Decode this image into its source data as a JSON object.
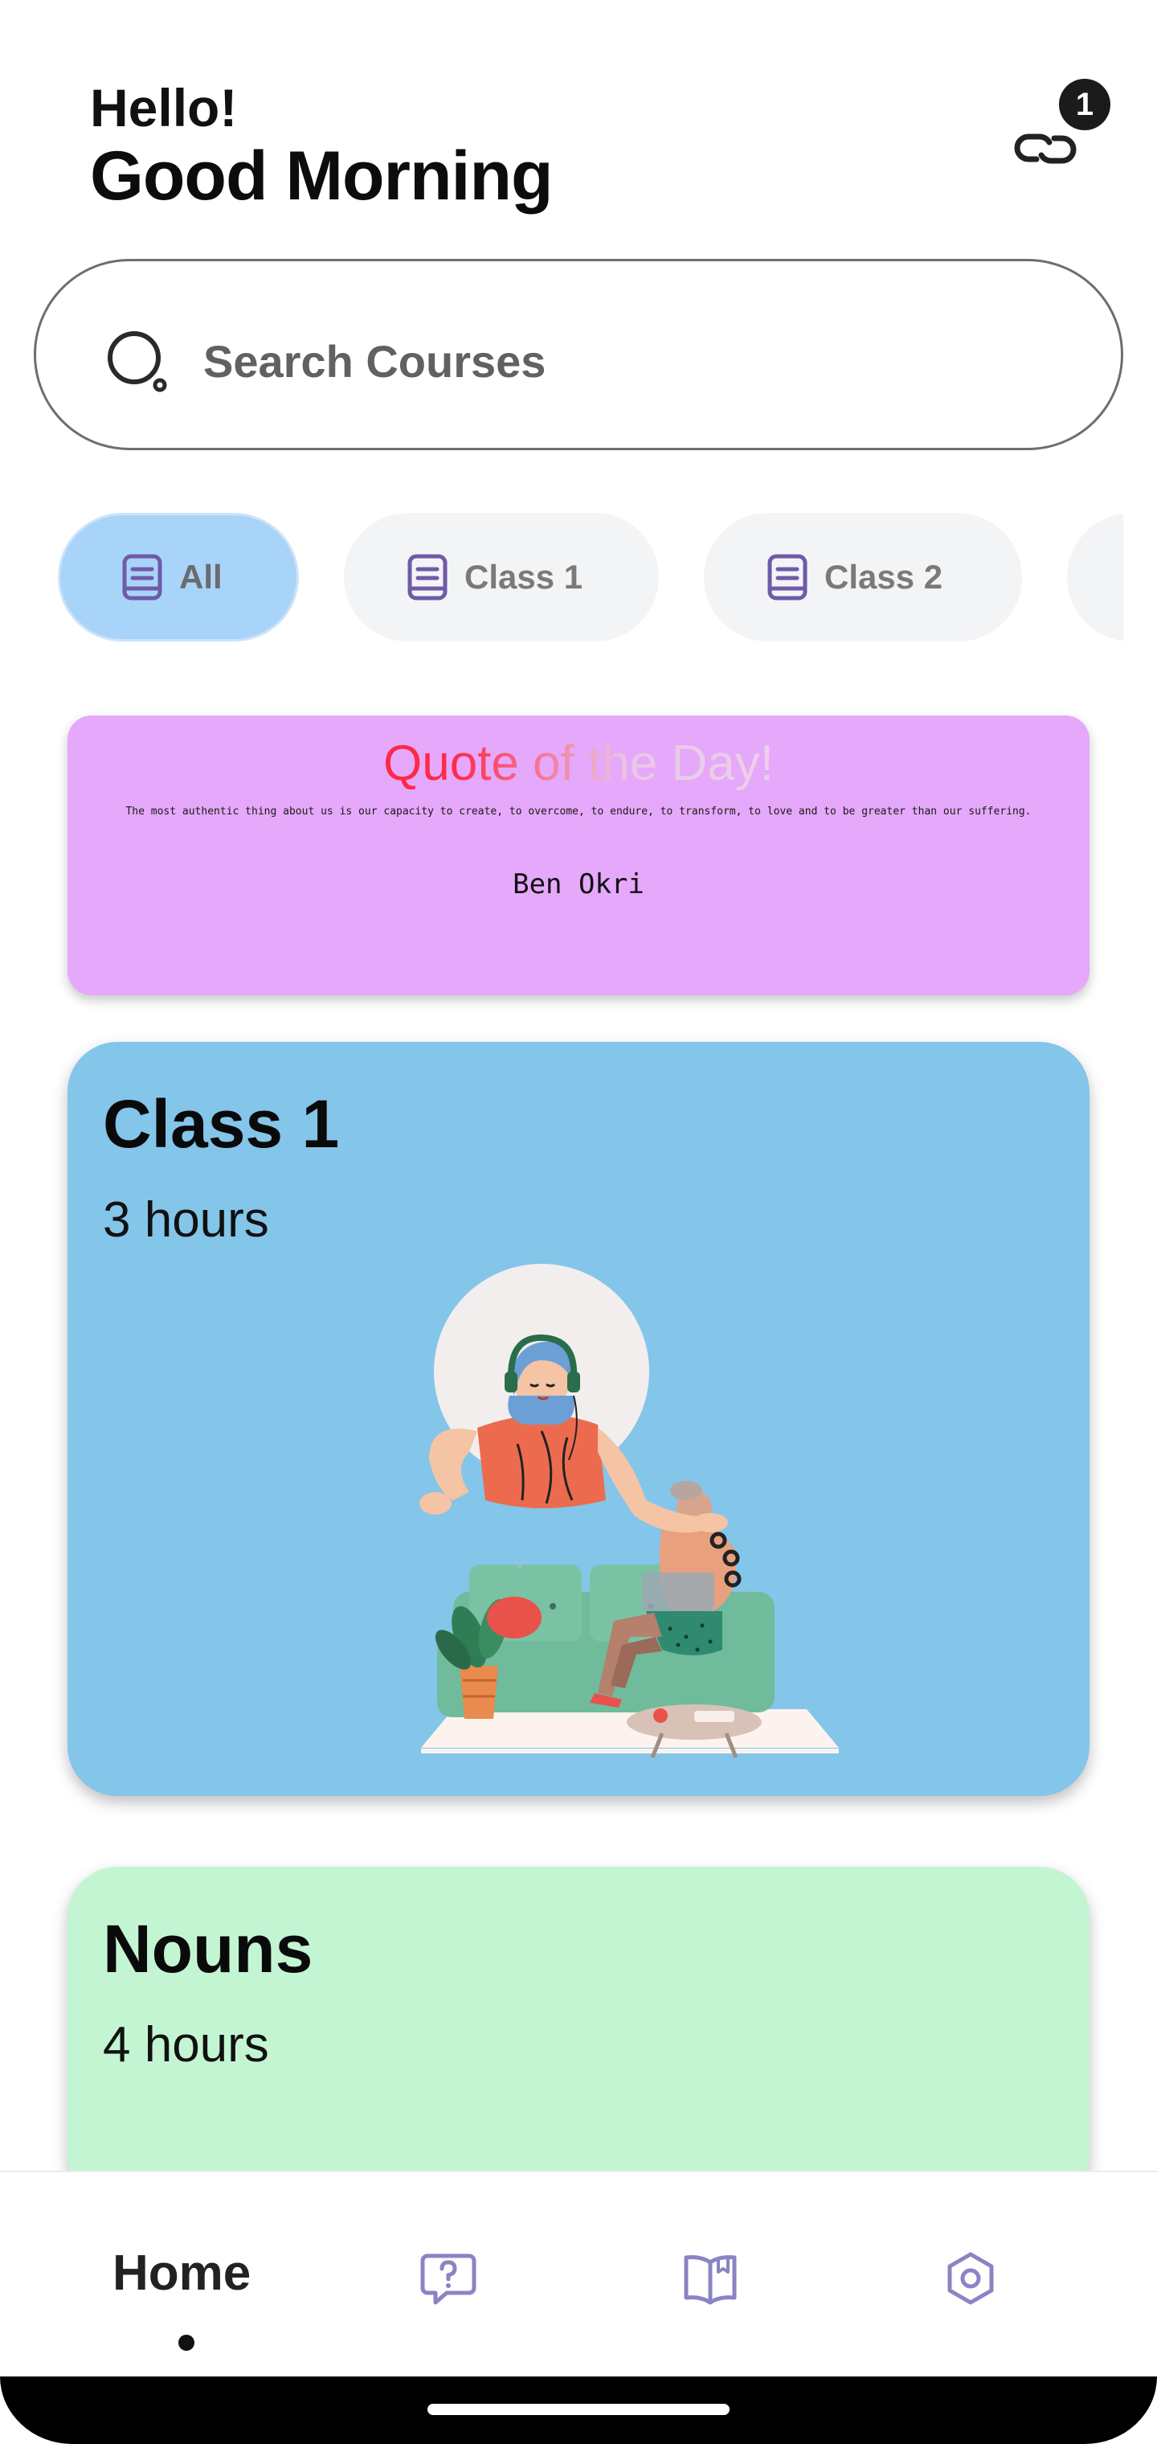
{
  "header": {
    "greeting": "Hello!",
    "time_greeting": "Good Morning",
    "notification_count": "1",
    "link_icon": "link-icon"
  },
  "search": {
    "placeholder": "Search Courses",
    "icon": "search-icon"
  },
  "categories": [
    {
      "label": "All",
      "active": true,
      "icon": "book-icon"
    },
    {
      "label": "Class 1",
      "active": false,
      "icon": "book-icon"
    },
    {
      "label": "Class 2",
      "active": false,
      "icon": "book-icon"
    }
  ],
  "quote": {
    "title": "Quote of the Day!",
    "text": "The most authentic thing about us is our capacity to create, to overcome, to endure, to transform, to love and to be greater than our suffering.",
    "author": "Ben Okri"
  },
  "courses": [
    {
      "title": "Class 1",
      "hours": "3 hours",
      "color": "#84c5ea"
    },
    {
      "title": "Nouns",
      "hours": "4 hours",
      "color": "#c4f5d3"
    }
  ],
  "nav": {
    "home_label": "Home",
    "items": [
      "question-chat-icon",
      "book-open-icon",
      "settings-hex-icon"
    ]
  },
  "colors": {
    "accent_chip": "#a8d4fa",
    "quote_bg": "#e5a8fa",
    "nav_icon": "#8a84c4"
  }
}
